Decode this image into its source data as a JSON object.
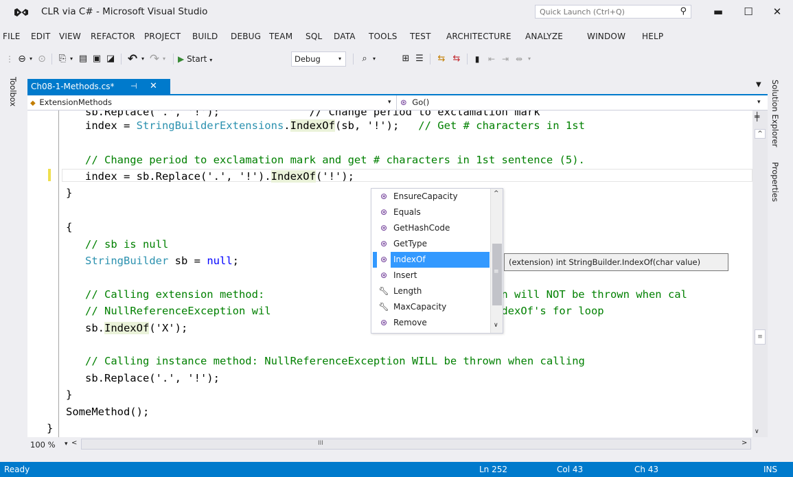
{
  "window": {
    "title": "CLR via C# - Microsoft Visual Studio",
    "quick_launch_placeholder": "Quick Launch (Ctrl+Q)",
    "minimize": "▬",
    "maximize": "☐",
    "close": "✕"
  },
  "menu": [
    "FILE",
    "EDIT",
    "VIEW",
    "REFACTOR",
    "PROJECT",
    "BUILD",
    "DEBUG",
    "TEAM",
    "SQL",
    "DATA",
    "TOOLS",
    "TEST",
    "ARCHITECTURE",
    "ANALYZE",
    "WINDOW",
    "HELP"
  ],
  "toolbar": {
    "start_label": "Start",
    "config_value": "Debug"
  },
  "side_tabs": {
    "toolbox": "Toolbox",
    "solution_explorer": "Solution Explorer",
    "properties": "Properties"
  },
  "document": {
    "tab_label": "Ch08-1-Methods.cs*",
    "pin": "⊣",
    "close": "✕"
  },
  "navbar": {
    "class_selector": "ExtensionMethods",
    "member_selector": "Go()"
  },
  "code": {
    "l0": "         sb.Replace('.', '!');              // Change period to exclamation mark",
    "l1_a": "         index = ",
    "l1_b": "StringBuilderExtensions",
    "l1_c": ".",
    "l1_d": "IndexOf",
    "l1_e": "(sb, '!');   ",
    "l1_f": "// Get # characters in 1st",
    "l2": "         // Change period to exclamation mark and get # characters in 1st sentence (5).",
    "l3_a": "         index = sb.Replace('.', '!').",
    "l3_b": "IndexOf",
    "l3_c": "('!');",
    "l4": "      }",
    "l5": "      {",
    "l6": "         // sb is null",
    "l7_a": "         ",
    "l7_b": "StringBuilder",
    "l7_c": " sb = ",
    "l7_d": "null",
    "l7_e": ";",
    "l8_a": "         ",
    "l8_b": "// Calling extension method:",
    "l8_c": "ption will NOT be thrown when cal",
    "l9_a": "         ",
    "l9_b": "// NullReferenceException wil",
    "l9_c": "e IndexOf's for loop",
    "l10_a": "         sb.",
    "l10_b": "IndexOf",
    "l10_c": "('X');",
    "l11": "         // Calling instance method: NullReferenceException WILL be thrown when calling",
    "l12": "         sb.Replace('.', '!');",
    "l13": "      }",
    "l14": "      SomeMethod();",
    "l15": "   }"
  },
  "completion": {
    "items": [
      "EnsureCapacity",
      "Equals",
      "GetHashCode",
      "GetType",
      "IndexOf",
      "Insert",
      "Length",
      "MaxCapacity",
      "Remove"
    ],
    "selected": "IndexOf",
    "tooltip": "(extension) int StringBuilder.IndexOf(char value)"
  },
  "editor": {
    "zoom": "100 %"
  },
  "status": {
    "state": "Ready",
    "line": "Ln 252",
    "col": "Col 43",
    "ch": "Ch 43",
    "mode": "INS"
  },
  "colors": {
    "accent": "#007acc",
    "keyword": "#0000ff",
    "type": "#2b91af",
    "comment": "#008000",
    "string": "#a31515",
    "selection": "#3399ff"
  }
}
